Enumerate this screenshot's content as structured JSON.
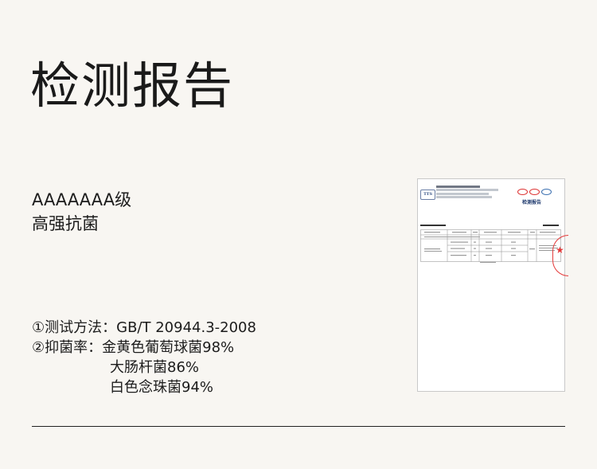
{
  "page": {
    "title": "检测报告",
    "grade_line1": "AAAAAAA级",
    "grade_line2": "高强抗菌",
    "spec_method": "①测试方法：GB/T 20944.3-2008",
    "spec_rate_label": "②抑菌率：",
    "spec_rate_1": "金黄色葡萄球菌98%",
    "spec_rate_2": "大肠杆菌86%",
    "spec_rate_3": "白色念珠菌94%"
  },
  "report_image": {
    "logo_text": "TTS",
    "report_title": "检测报告"
  },
  "colors": {
    "background": "#f8f6f2",
    "text": "#1c1c1c",
    "stamp_red": "#e43a3a",
    "report_blue": "#1f3a6e"
  }
}
